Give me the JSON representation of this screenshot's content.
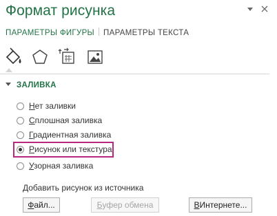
{
  "pane": {
    "title": "Формат рисунка",
    "dropdown_icon": "chevron-down-icon",
    "close_icon": "close-icon"
  },
  "tabs": [
    {
      "label": "ПАРАМЕТРЫ ФИГУРЫ",
      "active": true
    },
    {
      "label": "ПАРАМЕТРЫ ТЕКСТА",
      "active": false
    }
  ],
  "icons": [
    {
      "name": "fill-line-icon",
      "selected": true
    },
    {
      "name": "effects-pentagon-icon",
      "selected": false
    },
    {
      "name": "size-properties-icon",
      "selected": false
    },
    {
      "name": "picture-icon",
      "selected": false
    }
  ],
  "section": {
    "title": "ЗАЛИВКА",
    "options": [
      {
        "access": "Н",
        "rest": "ет заливки",
        "checked": false
      },
      {
        "access": "С",
        "rest": "плошная заливка",
        "checked": false
      },
      {
        "access": "Г",
        "rest": "радиентная заливка",
        "checked": false
      },
      {
        "access": "Р",
        "rest": "исунок или текстура",
        "checked": true
      },
      {
        "access": "У",
        "rest": "зорная заливка",
        "checked": false
      }
    ]
  },
  "source": {
    "label": "Добавить рисунок из источника",
    "buttons": [
      {
        "access": "Ф",
        "rest": "айл...",
        "enabled": true
      },
      {
        "access": "Б",
        "rest": "уфер обмена",
        "enabled": false
      },
      {
        "access": "В",
        "rest": " Интернете...",
        "enabled": true
      }
    ]
  },
  "colors": {
    "accent_green": "#217346",
    "highlight_magenta": "#b8277e"
  }
}
